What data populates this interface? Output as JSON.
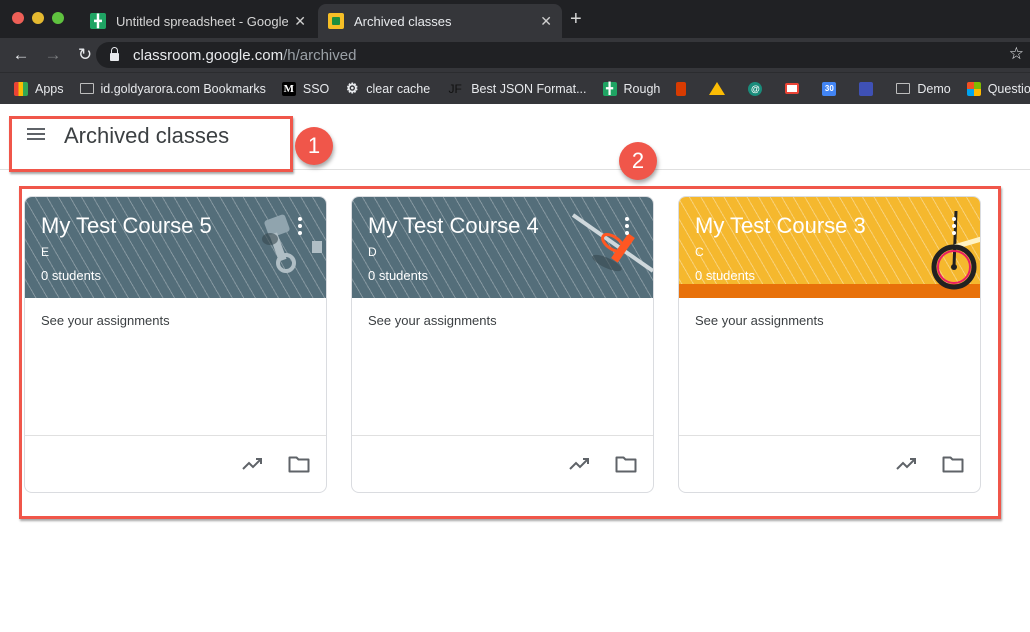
{
  "browser": {
    "tabs": [
      {
        "title": "Untitled spreadsheet - Google Sheets",
        "favicon": "sheets-icon",
        "active": false
      },
      {
        "title": "Archived classes",
        "favicon": "classroom-icon",
        "active": true
      }
    ],
    "new_tab_label": "+",
    "url": {
      "host": "classroom.google.com",
      "path": "/h/archived"
    },
    "bookmarks": [
      {
        "label": "Apps",
        "icon": "apps-icon"
      },
      {
        "label": "id.goldyarora.com Bookmarks",
        "icon": "folder-icon"
      },
      {
        "label": "SSO",
        "icon": "medium-icon"
      },
      {
        "label": "clear cache",
        "icon": "gear-icon"
      },
      {
        "label": "Best JSON Format...",
        "icon": "jf-icon"
      },
      {
        "label": "Rough",
        "icon": "sheets-icon"
      },
      {
        "label": "",
        "icon": "office-icon"
      },
      {
        "label": "",
        "icon": "drive-icon"
      },
      {
        "label": "",
        "icon": "hangouts-icon"
      },
      {
        "label": "",
        "icon": "gmail-icon"
      },
      {
        "label": "",
        "icon": "calendar-icon",
        "text": "30"
      },
      {
        "label": "",
        "icon": "slides-icon"
      },
      {
        "label": "Demo",
        "icon": "folder-icon"
      },
      {
        "label": "Questio",
        "icon": "microsoft-icon"
      }
    ]
  },
  "page": {
    "title": "Archived classes"
  },
  "annotations": {
    "badge1": "1",
    "badge2": "2",
    "color": "#f0564a"
  },
  "courses": [
    {
      "name": "My Test Course 5",
      "section": "E",
      "students": "0 students",
      "body": "See your assignments",
      "theme": "slate",
      "theme_color": "#546e7a"
    },
    {
      "name": "My Test Course 4",
      "section": "D",
      "students": "0 students",
      "body": "See your assignments",
      "theme": "slate",
      "theme_color": "#546e7a"
    },
    {
      "name": "My Test Course 3",
      "section": "C",
      "students": "0 students",
      "body": "See your assignments",
      "theme": "amber",
      "theme_color": "#f5b82e"
    }
  ]
}
